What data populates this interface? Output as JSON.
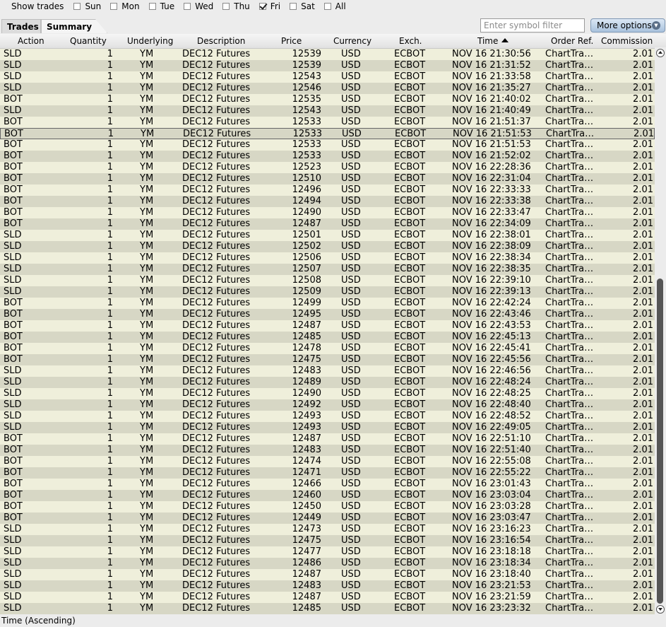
{
  "filter_bar": {
    "label": "Show trades",
    "days": [
      {
        "label": "Sun",
        "checked": false
      },
      {
        "label": "Mon",
        "checked": false
      },
      {
        "label": "Tue",
        "checked": false
      },
      {
        "label": "Wed",
        "checked": false
      },
      {
        "label": "Thu",
        "checked": false
      },
      {
        "label": "Fri",
        "checked": true
      },
      {
        "label": "Sat",
        "checked": false
      },
      {
        "label": "All",
        "checked": false
      }
    ]
  },
  "tabs": [
    {
      "label": "Trades",
      "active": false
    },
    {
      "label": "Summary",
      "active": true
    }
  ],
  "symbol_filter": {
    "placeholder": "Enter symbol filter",
    "value": ""
  },
  "more_options": {
    "label": "More options"
  },
  "columns": [
    "Action",
    "Quantity",
    "Underlying",
    "Description",
    "Price",
    "Currency",
    "Exch.",
    "Time",
    "Order Ref.",
    "Commission"
  ],
  "sorted_column": "Time",
  "selected_row_index": 7,
  "rows": [
    {
      "action": "SLD",
      "quantity": "1",
      "underlying": "YM",
      "description": "DEC12 Futures",
      "price": "12539",
      "currency": "USD",
      "exch": "ECBOT",
      "time": "NOV 16 21:30:56",
      "order_ref": "ChartTra…",
      "commission": "2.01"
    },
    {
      "action": "SLD",
      "quantity": "1",
      "underlying": "YM",
      "description": "DEC12 Futures",
      "price": "12539",
      "currency": "USD",
      "exch": "ECBOT",
      "time": "NOV 16 21:31:52",
      "order_ref": "ChartTra…",
      "commission": "2.01"
    },
    {
      "action": "SLD",
      "quantity": "1",
      "underlying": "YM",
      "description": "DEC12 Futures",
      "price": "12543",
      "currency": "USD",
      "exch": "ECBOT",
      "time": "NOV 16 21:33:58",
      "order_ref": "ChartTra…",
      "commission": "2.01"
    },
    {
      "action": "SLD",
      "quantity": "1",
      "underlying": "YM",
      "description": "DEC12 Futures",
      "price": "12546",
      "currency": "USD",
      "exch": "ECBOT",
      "time": "NOV 16 21:35:27",
      "order_ref": "ChartTra…",
      "commission": "2.01"
    },
    {
      "action": "BOT",
      "quantity": "1",
      "underlying": "YM",
      "description": "DEC12 Futures",
      "price": "12535",
      "currency": "USD",
      "exch": "ECBOT",
      "time": "NOV 16 21:40:02",
      "order_ref": "ChartTra…",
      "commission": "2.01"
    },
    {
      "action": "SLD",
      "quantity": "1",
      "underlying": "YM",
      "description": "DEC12 Futures",
      "price": "12543",
      "currency": "USD",
      "exch": "ECBOT",
      "time": "NOV 16 21:40:49",
      "order_ref": "ChartTra…",
      "commission": "2.01"
    },
    {
      "action": "BOT",
      "quantity": "1",
      "underlying": "YM",
      "description": "DEC12 Futures",
      "price": "12533",
      "currency": "USD",
      "exch": "ECBOT",
      "time": "NOV 16 21:51:37",
      "order_ref": "ChartTra…",
      "commission": "2.01"
    },
    {
      "action": "BOT",
      "quantity": "1",
      "underlying": "YM",
      "description": "DEC12 Futures",
      "price": "12533",
      "currency": "USD",
      "exch": "ECBOT",
      "time": "NOV 16 21:51:53",
      "order_ref": "ChartTra…",
      "commission": "2.01"
    },
    {
      "action": "BOT",
      "quantity": "1",
      "underlying": "YM",
      "description": "DEC12 Futures",
      "price": "12533",
      "currency": "USD",
      "exch": "ECBOT",
      "time": "NOV 16 21:51:53",
      "order_ref": "ChartTra…",
      "commission": "2.01"
    },
    {
      "action": "BOT",
      "quantity": "1",
      "underlying": "YM",
      "description": "DEC12 Futures",
      "price": "12533",
      "currency": "USD",
      "exch": "ECBOT",
      "time": "NOV 16 21:52:02",
      "order_ref": "ChartTra…",
      "commission": "2.01"
    },
    {
      "action": "BOT",
      "quantity": "1",
      "underlying": "YM",
      "description": "DEC12 Futures",
      "price": "12523",
      "currency": "USD",
      "exch": "ECBOT",
      "time": "NOV 16 22:28:36",
      "order_ref": "ChartTra…",
      "commission": "2.01"
    },
    {
      "action": "BOT",
      "quantity": "1",
      "underlying": "YM",
      "description": "DEC12 Futures",
      "price": "12510",
      "currency": "USD",
      "exch": "ECBOT",
      "time": "NOV 16 22:31:04",
      "order_ref": "ChartTra…",
      "commission": "2.01"
    },
    {
      "action": "BOT",
      "quantity": "1",
      "underlying": "YM",
      "description": "DEC12 Futures",
      "price": "12496",
      "currency": "USD",
      "exch": "ECBOT",
      "time": "NOV 16 22:33:33",
      "order_ref": "ChartTra…",
      "commission": "2.01"
    },
    {
      "action": "BOT",
      "quantity": "1",
      "underlying": "YM",
      "description": "DEC12 Futures",
      "price": "12494",
      "currency": "USD",
      "exch": "ECBOT",
      "time": "NOV 16 22:33:38",
      "order_ref": "ChartTra…",
      "commission": "2.01"
    },
    {
      "action": "BOT",
      "quantity": "1",
      "underlying": "YM",
      "description": "DEC12 Futures",
      "price": "12490",
      "currency": "USD",
      "exch": "ECBOT",
      "time": "NOV 16 22:33:47",
      "order_ref": "ChartTra…",
      "commission": "2.01"
    },
    {
      "action": "BOT",
      "quantity": "1",
      "underlying": "YM",
      "description": "DEC12 Futures",
      "price": "12487",
      "currency": "USD",
      "exch": "ECBOT",
      "time": "NOV 16 22:34:09",
      "order_ref": "ChartTra…",
      "commission": "2.01"
    },
    {
      "action": "SLD",
      "quantity": "1",
      "underlying": "YM",
      "description": "DEC12 Futures",
      "price": "12501",
      "currency": "USD",
      "exch": "ECBOT",
      "time": "NOV 16 22:38:01",
      "order_ref": "ChartTra…",
      "commission": "2.01"
    },
    {
      "action": "SLD",
      "quantity": "1",
      "underlying": "YM",
      "description": "DEC12 Futures",
      "price": "12502",
      "currency": "USD",
      "exch": "ECBOT",
      "time": "NOV 16 22:38:09",
      "order_ref": "ChartTra…",
      "commission": "2.01"
    },
    {
      "action": "SLD",
      "quantity": "1",
      "underlying": "YM",
      "description": "DEC12 Futures",
      "price": "12506",
      "currency": "USD",
      "exch": "ECBOT",
      "time": "NOV 16 22:38:34",
      "order_ref": "ChartTra…",
      "commission": "2.01"
    },
    {
      "action": "SLD",
      "quantity": "1",
      "underlying": "YM",
      "description": "DEC12 Futures",
      "price": "12507",
      "currency": "USD",
      "exch": "ECBOT",
      "time": "NOV 16 22:38:35",
      "order_ref": "ChartTra…",
      "commission": "2.01"
    },
    {
      "action": "SLD",
      "quantity": "1",
      "underlying": "YM",
      "description": "DEC12 Futures",
      "price": "12508",
      "currency": "USD",
      "exch": "ECBOT",
      "time": "NOV 16 22:39:10",
      "order_ref": "ChartTra…",
      "commission": "2.01"
    },
    {
      "action": "SLD",
      "quantity": "1",
      "underlying": "YM",
      "description": "DEC12 Futures",
      "price": "12509",
      "currency": "USD",
      "exch": "ECBOT",
      "time": "NOV 16 22:39:13",
      "order_ref": "ChartTra…",
      "commission": "2.01"
    },
    {
      "action": "BOT",
      "quantity": "1",
      "underlying": "YM",
      "description": "DEC12 Futures",
      "price": "12499",
      "currency": "USD",
      "exch": "ECBOT",
      "time": "NOV 16 22:42:24",
      "order_ref": "ChartTra…",
      "commission": "2.01"
    },
    {
      "action": "BOT",
      "quantity": "1",
      "underlying": "YM",
      "description": "DEC12 Futures",
      "price": "12495",
      "currency": "USD",
      "exch": "ECBOT",
      "time": "NOV 16 22:43:46",
      "order_ref": "ChartTra…",
      "commission": "2.01"
    },
    {
      "action": "BOT",
      "quantity": "1",
      "underlying": "YM",
      "description": "DEC12 Futures",
      "price": "12487",
      "currency": "USD",
      "exch": "ECBOT",
      "time": "NOV 16 22:43:53",
      "order_ref": "ChartTra…",
      "commission": "2.01"
    },
    {
      "action": "BOT",
      "quantity": "1",
      "underlying": "YM",
      "description": "DEC12 Futures",
      "price": "12485",
      "currency": "USD",
      "exch": "ECBOT",
      "time": "NOV 16 22:45:13",
      "order_ref": "ChartTra…",
      "commission": "2.01"
    },
    {
      "action": "BOT",
      "quantity": "1",
      "underlying": "YM",
      "description": "DEC12 Futures",
      "price": "12478",
      "currency": "USD",
      "exch": "ECBOT",
      "time": "NOV 16 22:45:41",
      "order_ref": "ChartTra…",
      "commission": "2.01"
    },
    {
      "action": "BOT",
      "quantity": "1",
      "underlying": "YM",
      "description": "DEC12 Futures",
      "price": "12475",
      "currency": "USD",
      "exch": "ECBOT",
      "time": "NOV 16 22:45:56",
      "order_ref": "ChartTra…",
      "commission": "2.01"
    },
    {
      "action": "SLD",
      "quantity": "1",
      "underlying": "YM",
      "description": "DEC12 Futures",
      "price": "12483",
      "currency": "USD",
      "exch": "ECBOT",
      "time": "NOV 16 22:46:56",
      "order_ref": "ChartTra…",
      "commission": "2.01"
    },
    {
      "action": "SLD",
      "quantity": "1",
      "underlying": "YM",
      "description": "DEC12 Futures",
      "price": "12489",
      "currency": "USD",
      "exch": "ECBOT",
      "time": "NOV 16 22:48:24",
      "order_ref": "ChartTra…",
      "commission": "2.01"
    },
    {
      "action": "SLD",
      "quantity": "1",
      "underlying": "YM",
      "description": "DEC12 Futures",
      "price": "12490",
      "currency": "USD",
      "exch": "ECBOT",
      "time": "NOV 16 22:48:25",
      "order_ref": "ChartTra…",
      "commission": "2.01"
    },
    {
      "action": "SLD",
      "quantity": "1",
      "underlying": "YM",
      "description": "DEC12 Futures",
      "price": "12492",
      "currency": "USD",
      "exch": "ECBOT",
      "time": "NOV 16 22:48:40",
      "order_ref": "ChartTra…",
      "commission": "2.01"
    },
    {
      "action": "SLD",
      "quantity": "1",
      "underlying": "YM",
      "description": "DEC12 Futures",
      "price": "12493",
      "currency": "USD",
      "exch": "ECBOT",
      "time": "NOV 16 22:48:52",
      "order_ref": "ChartTra…",
      "commission": "2.01"
    },
    {
      "action": "SLD",
      "quantity": "1",
      "underlying": "YM",
      "description": "DEC12 Futures",
      "price": "12493",
      "currency": "USD",
      "exch": "ECBOT",
      "time": "NOV 16 22:49:05",
      "order_ref": "ChartTra…",
      "commission": "2.01"
    },
    {
      "action": "BOT",
      "quantity": "1",
      "underlying": "YM",
      "description": "DEC12 Futures",
      "price": "12487",
      "currency": "USD",
      "exch": "ECBOT",
      "time": "NOV 16 22:51:10",
      "order_ref": "ChartTra…",
      "commission": "2.01"
    },
    {
      "action": "BOT",
      "quantity": "1",
      "underlying": "YM",
      "description": "DEC12 Futures",
      "price": "12483",
      "currency": "USD",
      "exch": "ECBOT",
      "time": "NOV 16 22:51:40",
      "order_ref": "ChartTra…",
      "commission": "2.01"
    },
    {
      "action": "BOT",
      "quantity": "1",
      "underlying": "YM",
      "description": "DEC12 Futures",
      "price": "12474",
      "currency": "USD",
      "exch": "ECBOT",
      "time": "NOV 16 22:55:08",
      "order_ref": "ChartTra…",
      "commission": "2.01"
    },
    {
      "action": "BOT",
      "quantity": "1",
      "underlying": "YM",
      "description": "DEC12 Futures",
      "price": "12471",
      "currency": "USD",
      "exch": "ECBOT",
      "time": "NOV 16 22:55:22",
      "order_ref": "ChartTra…",
      "commission": "2.01"
    },
    {
      "action": "BOT",
      "quantity": "1",
      "underlying": "YM",
      "description": "DEC12 Futures",
      "price": "12466",
      "currency": "USD",
      "exch": "ECBOT",
      "time": "NOV 16 23:01:43",
      "order_ref": "ChartTra…",
      "commission": "2.01"
    },
    {
      "action": "BOT",
      "quantity": "1",
      "underlying": "YM",
      "description": "DEC12 Futures",
      "price": "12460",
      "currency": "USD",
      "exch": "ECBOT",
      "time": "NOV 16 23:03:04",
      "order_ref": "ChartTra…",
      "commission": "2.01"
    },
    {
      "action": "BOT",
      "quantity": "1",
      "underlying": "YM",
      "description": "DEC12 Futures",
      "price": "12450",
      "currency": "USD",
      "exch": "ECBOT",
      "time": "NOV 16 23:03:28",
      "order_ref": "ChartTra…",
      "commission": "2.01"
    },
    {
      "action": "BOT",
      "quantity": "1",
      "underlying": "YM",
      "description": "DEC12 Futures",
      "price": "12449",
      "currency": "USD",
      "exch": "ECBOT",
      "time": "NOV 16 23:03:47",
      "order_ref": "ChartTra…",
      "commission": "2.01"
    },
    {
      "action": "SLD",
      "quantity": "1",
      "underlying": "YM",
      "description": "DEC12 Futures",
      "price": "12473",
      "currency": "USD",
      "exch": "ECBOT",
      "time": "NOV 16 23:16:23",
      "order_ref": "ChartTra…",
      "commission": "2.01"
    },
    {
      "action": "SLD",
      "quantity": "1",
      "underlying": "YM",
      "description": "DEC12 Futures",
      "price": "12475",
      "currency": "USD",
      "exch": "ECBOT",
      "time": "NOV 16 23:16:54",
      "order_ref": "ChartTra…",
      "commission": "2.01"
    },
    {
      "action": "SLD",
      "quantity": "1",
      "underlying": "YM",
      "description": "DEC12 Futures",
      "price": "12477",
      "currency": "USD",
      "exch": "ECBOT",
      "time": "NOV 16 23:18:18",
      "order_ref": "ChartTra…",
      "commission": "2.01"
    },
    {
      "action": "SLD",
      "quantity": "1",
      "underlying": "YM",
      "description": "DEC12 Futures",
      "price": "12486",
      "currency": "USD",
      "exch": "ECBOT",
      "time": "NOV 16 23:18:34",
      "order_ref": "ChartTra…",
      "commission": "2.01"
    },
    {
      "action": "SLD",
      "quantity": "1",
      "underlying": "YM",
      "description": "DEC12 Futures",
      "price": "12487",
      "currency": "USD",
      "exch": "ECBOT",
      "time": "NOV 16 23:18:40",
      "order_ref": "ChartTra…",
      "commission": "2.01"
    },
    {
      "action": "SLD",
      "quantity": "1",
      "underlying": "YM",
      "description": "DEC12 Futures",
      "price": "12483",
      "currency": "USD",
      "exch": "ECBOT",
      "time": "NOV 16 23:21:53",
      "order_ref": "ChartTra…",
      "commission": "2.01"
    },
    {
      "action": "SLD",
      "quantity": "1",
      "underlying": "YM",
      "description": "DEC12 Futures",
      "price": "12487",
      "currency": "USD",
      "exch": "ECBOT",
      "time": "NOV 16 23:21:59",
      "order_ref": "ChartTra…",
      "commission": "2.01"
    },
    {
      "action": "SLD",
      "quantity": "1",
      "underlying": "YM",
      "description": "DEC12 Futures",
      "price": "12485",
      "currency": "USD",
      "exch": "ECBOT",
      "time": "NOV 16 23:23:32",
      "order_ref": "ChartTra…",
      "commission": "2.01"
    }
  ],
  "status_bar": {
    "text": "Time (Ascending)"
  }
}
